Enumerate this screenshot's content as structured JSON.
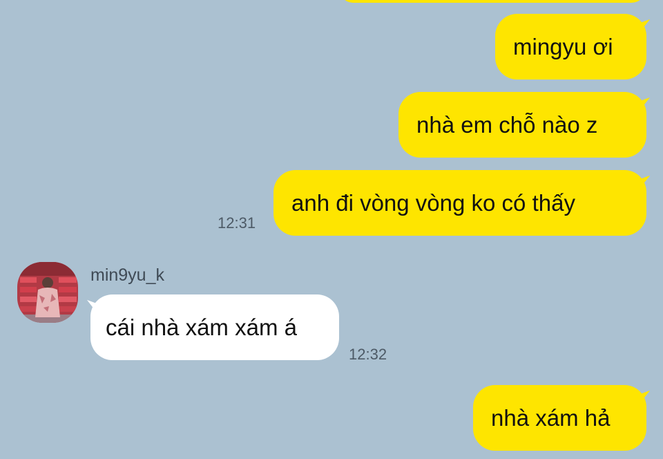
{
  "chat": {
    "outgoing_1": "mingyu ơi",
    "outgoing_2": "nhà em chỗ nào z",
    "outgoing_3": "anh đi vòng vòng ko có thấy",
    "time_1": "12:31",
    "sender_name": "min9yu_k",
    "incoming_1": "cái nhà xám xám á",
    "time_2": "12:32",
    "outgoing_4": "nhà xám hả"
  },
  "colors": {
    "background": "#abc1d1",
    "outgoing_bubble": "#fee500",
    "incoming_bubble": "#ffffff"
  },
  "icons": {
    "avatar": "profile-photo"
  }
}
